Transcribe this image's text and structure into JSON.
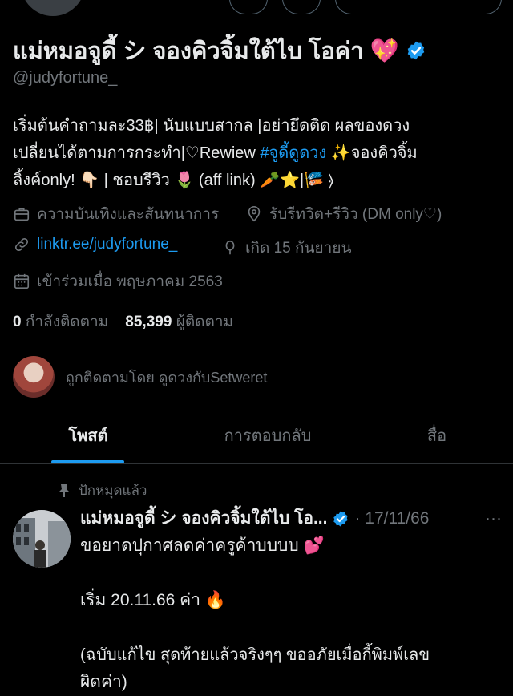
{
  "profile": {
    "display_name": "แม่หมอจูดี้ シ จองคิวจิ้มใต้ไบ โอค่า 💖",
    "handle": "@judyfortune_",
    "bio_line1": "เริ่มต้นคำถามละ33฿| นับแบบสากล |อย่ายึดติด ผลของดวง",
    "bio_line2_pre": "เปลี่ยนได้ตามการกระทำ|♡Rewiew ",
    "bio_hashtag": "#จูดี้ดูดวง",
    "bio_line2_post": " ✨จองคิวจิ้ม",
    "bio_line3": "ลิ้งค์only! 👇🏻 | ชอบรีวิว 🌷 (aff link) 🥕⭐️|🎏 ⦒",
    "category": "ความบันเทิงและสันทนาการ",
    "location": "รับรีทวิต+รีวิว (DM only♡)",
    "website": "linktr.ee/judyfortune_",
    "birthday": "เกิด 15 กันยายน",
    "joined": "เข้าร่วมเมื่อ พฤษภาคม 2563",
    "following_count": "0",
    "following_label": "กำลังติดตาม",
    "followers_count": "85,399",
    "followers_label": "ผู้ติดตาม",
    "followed_by": "ถูกติดตามโดย ดูดวงกับSetweret"
  },
  "tabs": [
    {
      "label": "โพสต์",
      "active": true
    },
    {
      "label": "การตอบกลับ",
      "active": false
    },
    {
      "label": "สื่อ",
      "active": false
    }
  ],
  "post": {
    "pinned_label": "ปักหมุดแล้ว",
    "author": "แม่หมอจูดี้ シ จองคิวจิ้มใต้ไบ โอ...",
    "date": "· 17/11/66",
    "more": "···",
    "line1": "ขอยาดปุกาศลดค่าครูค้าบบบบ 💕",
    "line2": "เริ่ม 20.11.66 ค่า 🔥",
    "line3": "(ฉบับแก้ไข สุดท้ายแล้วจริงๆๆ ขออภัยเมื่อกี้พิมพ์เลข",
    "line4": "ผิดค่า)"
  },
  "colors": {
    "accent": "#1d9bf0",
    "muted": "#71767b",
    "text": "#e7e9ea",
    "background": "#000000"
  }
}
